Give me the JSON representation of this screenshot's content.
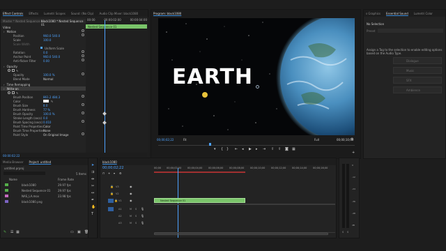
{
  "effect_controls": {
    "tabs": [
      "Effect Controls",
      "Effects",
      "Lumetri Scopes",
      "Sound: (No Clip)",
      "Audio Clip Mixer: black1080"
    ],
    "source_label": "Master * Nested Sequence 01",
    "clip_label": "black1080 * Nested Sequence 01",
    "timeline_clip": "Nested Sequence 01",
    "time_marks": [
      "00:00",
      "00:00:02:00",
      "00:00:04:00"
    ],
    "sections": {
      "video": "Video",
      "motion": "Motion",
      "opacity": "Opacity",
      "time_remapping": "Time Remapping",
      "write_on": "Write-on"
    },
    "props": [
      {
        "label": "Position",
        "value": "960.0   540.0"
      },
      {
        "label": "Scale",
        "value": "100.0"
      },
      {
        "label": "Scale Width",
        "value": ""
      },
      {
        "label": "",
        "value": "Uniform Scale"
      },
      {
        "label": "Rotation",
        "value": "0.0"
      },
      {
        "label": "Anchor Point",
        "value": "960.0   540.0"
      },
      {
        "label": "Anti-flicker Filter",
        "value": "0.00"
      },
      {
        "label": "Opacity",
        "value": "100.0 %"
      },
      {
        "label": "Blend Mode",
        "value": "Normal"
      },
      {
        "label": "Brush Position",
        "value": "861.2   484.3"
      },
      {
        "label": "Color",
        "value": ""
      },
      {
        "label": "Brush Size",
        "value": "8.0"
      },
      {
        "label": "Brush Hardness",
        "value": "77 %"
      },
      {
        "label": "Brush Opacity",
        "value": "100.0 %"
      },
      {
        "label": "Stroke Length (secs)",
        "value": "0.0"
      },
      {
        "label": "Brush Spacing (secs)",
        "value": "0.010"
      },
      {
        "label": "Paint Time Properties",
        "value": "Color"
      },
      {
        "label": "Brush Time Properties",
        "value": "None"
      },
      {
        "label": "Paint Style",
        "value": "On Original Image"
      }
    ],
    "bottom_timecode": "00:00:02:22"
  },
  "program": {
    "title": "Program: black1080",
    "overlay_text": "EARTH",
    "timecode": "00;00;02;22",
    "fit": "Fit",
    "quality": "Full",
    "duration": "00;00;10;00",
    "colors": {
      "space": "#050608",
      "planet_light": "#6fb3d8",
      "planet_dark": "#0d2a44"
    }
  },
  "right_panel": {
    "tabs": [
      "s Graphics",
      "Essential Sound",
      "Lumetri Color"
    ],
    "no_selection": "No Selection",
    "presets_label": "Preset",
    "message": "Assign a Tag to the selection to enable editing options based on the Audio Type.",
    "buttons": [
      "Dialogue",
      "Music",
      "SFX",
      "Ambience"
    ]
  },
  "project": {
    "tabs": [
      "Media Browser",
      "Project: untitled"
    ],
    "file": "untitled.prproj",
    "items_count": "5 Items",
    "columns": {
      "name": "Name",
      "frame_rate": "Frame Rate"
    },
    "items": [
      {
        "name": "black1080",
        "rate": "29.97 fps",
        "color": "#55b04a"
      },
      {
        "name": "Nested Sequence 01",
        "rate": "29.97 fps",
        "color": "#55b04a"
      },
      {
        "name": "NAS_LA.mov",
        "rate": "23.98 fps",
        "color": "#c66bbf"
      },
      {
        "name": "black1080.png",
        "rate": "",
        "color": "#7c64c4"
      }
    ]
  },
  "timeline": {
    "title": "black1080",
    "timecode": "00;00;02;22",
    "ruler": [
      "00;00",
      "00;00;02;00",
      "00;00;04;00",
      "00;00;06;00",
      "00;00;08;00",
      "00;00;10;00",
      "00;00;12;00",
      "00;00;14;00",
      "00;00;16;00",
      "00;00;18;00"
    ],
    "video_tracks": [
      "V3",
      "V2",
      "V1"
    ],
    "audio_tracks": [
      "A1",
      "A2",
      "A3"
    ],
    "clip_label": "Nested Sequence 01",
    "clip_color": "#7ac46a"
  },
  "meters": {
    "labels": [
      "0",
      "-12",
      "-24",
      "-36",
      "-48",
      "dB"
    ],
    "bottom": [
      "S",
      "S"
    ]
  }
}
